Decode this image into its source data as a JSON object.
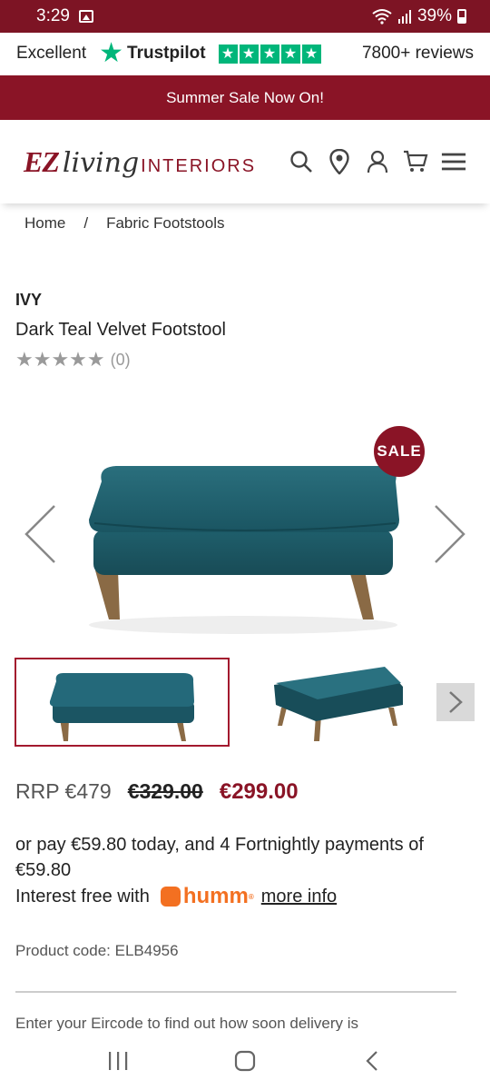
{
  "status": {
    "time": "3:29",
    "battery": "39%"
  },
  "trustpilot": {
    "rating_word": "Excellent",
    "brand": "Trustpilot",
    "reviews": "7800+ reviews"
  },
  "promo": {
    "text": "Summer Sale Now On!"
  },
  "header": {
    "logo_ez": "EZ",
    "logo_living": "living",
    "logo_interiors": "INTERIORS",
    "icons": [
      "search-icon",
      "location-pin-icon",
      "account-icon",
      "cart-icon",
      "menu-icon"
    ]
  },
  "breadcrumb": {
    "home": "Home",
    "separator": "/",
    "category": "Fabric Footstools"
  },
  "product": {
    "brand": "IVY",
    "title": "Dark Teal Velvet Footstool",
    "stars": "★★★★★",
    "review_count": "(0)",
    "rating": 0,
    "sale_badge": "SALE",
    "rrp": "RRP €479",
    "old_price": "€329.00",
    "price": "€299.00",
    "payments_text": "or pay €59.80 today, and 4 Fortnightly payments of €59.80",
    "interest_text": "Interest free with",
    "humm_brand": "humm",
    "humm_mark": "®",
    "more_info": "more info",
    "product_code": "Product code: ELB4956",
    "eircode_text": "Enter your Eircode to find out how soon delivery is"
  },
  "colors": {
    "brand_red": "#8a1426",
    "trustpilot_green": "#00b67a",
    "humm_orange": "#f37021",
    "teal": "#1d5d6b"
  }
}
